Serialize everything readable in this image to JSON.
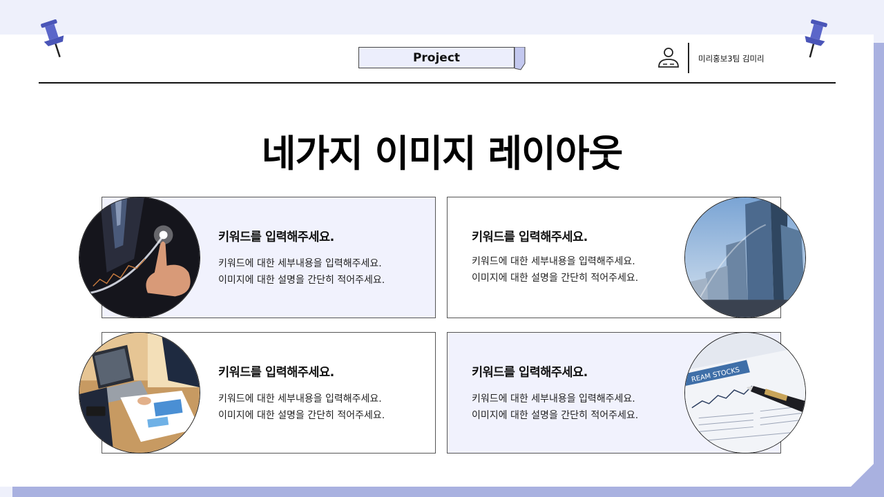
{
  "header": {
    "tag_label": "Project",
    "team_label": "미리홍보3팀 김미리"
  },
  "title": "네가지 이미지 레이아웃",
  "cards": [
    {
      "keyword": "키워드를 입력해주세요.",
      "line1": "키워드에 대한 세부내용을 입력해주세요.",
      "line2": "이미지에 대한 설명을 간단히 적어주세요."
    },
    {
      "keyword": "키워드를 입력해주세요.",
      "line1": "키워드에 대한 세부내용을 입력해주세요.",
      "line2": "이미지에 대한 설명을 간단히 적어주세요."
    },
    {
      "keyword": "키워드를 입력해주세요.",
      "line1": "키워드에 대한 세부내용을 입력해주세요.",
      "line2": "이미지에 대한 설명을 간단히 적어주세요."
    },
    {
      "keyword": "키워드를 입력해주세요.",
      "line1": "키워드에 대한 세부내용을 입력해주세요.",
      "line2": "이미지에 대한 설명을 간단히 적어주세요."
    }
  ],
  "icons": {
    "pins": "pushpin-icon",
    "team": "user-icon"
  },
  "colors": {
    "accent": "#5b66c9",
    "tint": "#f1f2fd",
    "frame": "#a9b1e0"
  }
}
